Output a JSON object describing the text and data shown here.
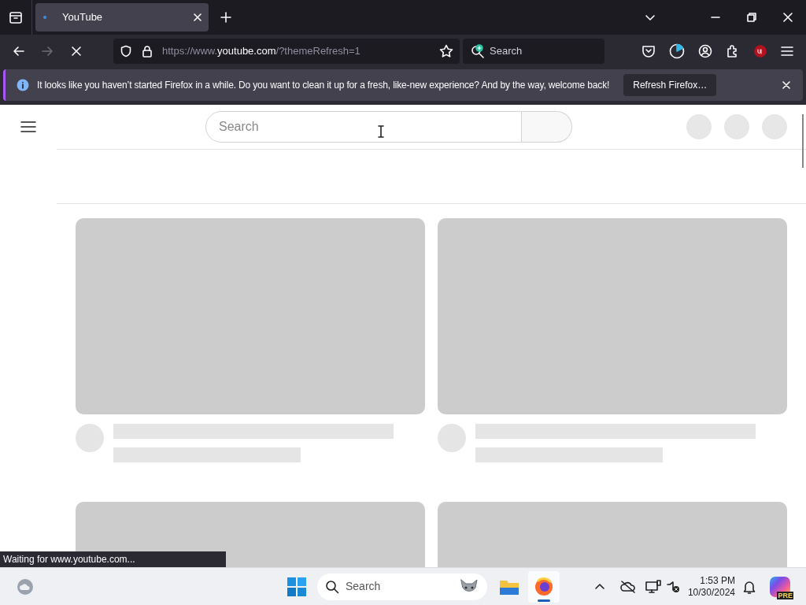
{
  "tabs": [
    {
      "title": "YouTube",
      "selected": true
    }
  ],
  "address": {
    "prefix": "https://www.",
    "domain": "youtube.com",
    "path": "/?themeRefresh=1"
  },
  "toolbar_search": {
    "placeholder": "Search"
  },
  "notification": {
    "message": "It looks like you haven’t started Firefox in a while. Do you want to clean it up for a fresh, like-new experience? And by the way, welcome back!",
    "button": "Refresh Firefox…"
  },
  "page": {
    "search": {
      "placeholder": "Search"
    },
    "video_cards": [
      {
        "kind": "skeleton"
      },
      {
        "kind": "skeleton"
      },
      {
        "kind": "thumbnail_only"
      },
      {
        "kind": "thumbnail_only"
      }
    ]
  },
  "status": "Waiting for www.youtube.com...",
  "taskbar": {
    "search": {
      "placeholder": "Search"
    },
    "apps": [
      {
        "kind": "files",
        "running": false
      },
      {
        "kind": "firefox",
        "running": true
      }
    ],
    "clock": {
      "time": "1:53 PM",
      "date": "10/30/2024"
    },
    "copilot_badge": "PRE"
  }
}
